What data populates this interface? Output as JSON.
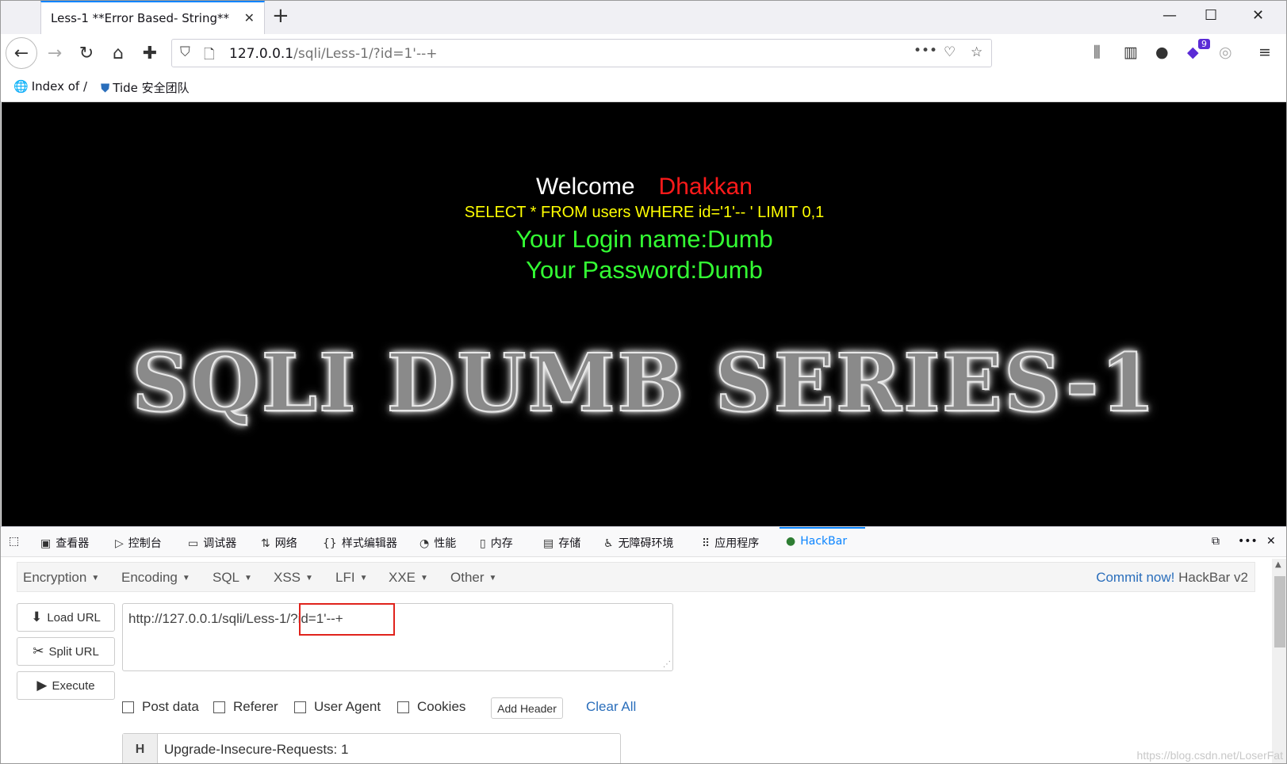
{
  "browser": {
    "tab_title": "Less-1 **Error Based- String**",
    "tab_close": "✕",
    "new_tab": "+",
    "url_host": "127.0.0.1",
    "url_path": "/sqli/Less-1/?id=1'--+",
    "bookmarks": [
      {
        "label": "Index of /"
      },
      {
        "label": "Tide 安全团队"
      }
    ],
    "extension_badge": "9"
  },
  "page": {
    "welcome": "Welcome",
    "username": "Dhakkan",
    "query": "SELECT * FROM users WHERE id='1'-- ' LIMIT 0,1",
    "login_name": "Your Login name:Dumb",
    "password": "Your Password:Dumb",
    "banner": "SQLI DUMB SERIES-1"
  },
  "devtools": {
    "tabs": [
      {
        "label": "查看器"
      },
      {
        "label": "控制台"
      },
      {
        "label": "调试器"
      },
      {
        "label": "网络"
      },
      {
        "label": "样式编辑器"
      },
      {
        "label": "性能"
      },
      {
        "label": "内存"
      },
      {
        "label": "存储"
      },
      {
        "label": "无障碍环境"
      },
      {
        "label": "应用程序"
      },
      {
        "label": "HackBar"
      }
    ]
  },
  "hackbar": {
    "menu": [
      {
        "label": "Encryption"
      },
      {
        "label": "Encoding"
      },
      {
        "label": "SQL"
      },
      {
        "label": "XSS"
      },
      {
        "label": "LFI"
      },
      {
        "label": "XXE"
      },
      {
        "label": "Other"
      }
    ],
    "commit_link": "Commit now!",
    "commit_version": "HackBar v2",
    "load_url": "Load URL",
    "split_url": "Split URL",
    "execute": "Execute",
    "url_value": "http://127.0.0.1/sqli/Less-1/?id=1'--+",
    "options": {
      "post_data": "Post data",
      "referer": "Referer",
      "user_agent": "User Agent",
      "cookies": "Cookies"
    },
    "add_header": "Add Header",
    "clear_all": "Clear All",
    "header_key": "H",
    "header_value": "Upgrade-Insecure-Requests: 1"
  },
  "watermark": "https://blog.csdn.net/LoserFat"
}
